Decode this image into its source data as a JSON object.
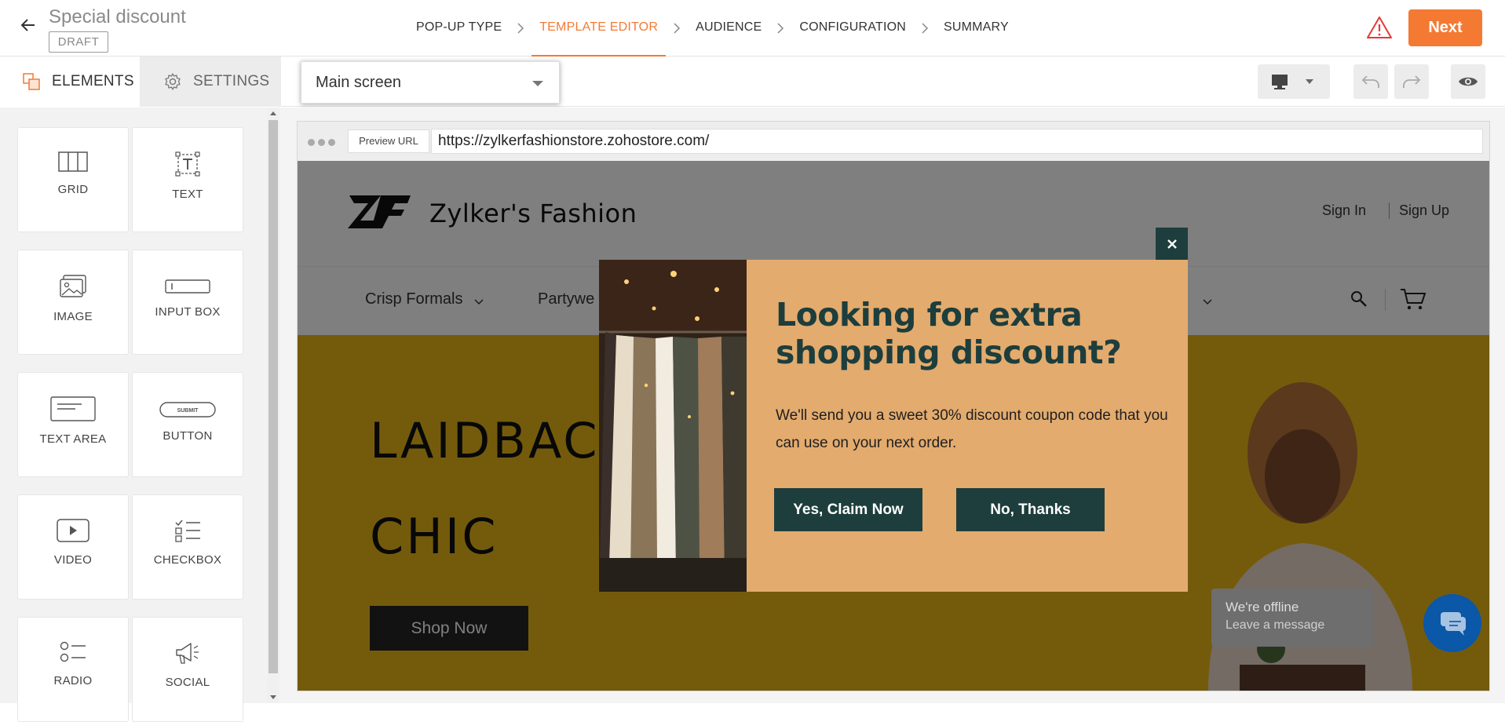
{
  "header": {
    "title": "Special discount",
    "status_badge": "DRAFT",
    "steps": [
      "POP-UP TYPE",
      "TEMPLATE EDITOR",
      "AUDIENCE",
      "CONFIGURATION",
      "SUMMARY"
    ],
    "active_step": "TEMPLATE EDITOR",
    "next_label": "Next",
    "accent_color": "#f47a34"
  },
  "toolbar": {
    "tab_elements": "ELEMENTS",
    "tab_settings": "SETTINGS",
    "screen_select_value": "Main screen",
    "device_icon": "desktop-icon"
  },
  "elements_panel": {
    "tiles": [
      {
        "label": "GRID",
        "icon": "grid-icon"
      },
      {
        "label": "TEXT",
        "icon": "text-icon"
      },
      {
        "label": "IMAGE",
        "icon": "image-icon"
      },
      {
        "label": "INPUT BOX",
        "icon": "input-box-icon"
      },
      {
        "label": "TEXT AREA",
        "icon": "text-area-icon"
      },
      {
        "label": "BUTTON",
        "icon": "button-icon"
      },
      {
        "label": "VIDEO",
        "icon": "video-icon"
      },
      {
        "label": "CHECKBOX",
        "icon": "checkbox-icon"
      },
      {
        "label": "RADIO",
        "icon": "radio-icon"
      },
      {
        "label": "SOCIAL",
        "icon": "megaphone-icon"
      }
    ],
    "button_icon_text": "SUBMIT"
  },
  "preview": {
    "url_label": "Preview URL",
    "url": "https://zylkerfashionstore.zohostore.com/",
    "site": {
      "brand": "Zylker's Fashion",
      "sign_in": "Sign In",
      "sign_up": "Sign Up",
      "nav_items": [
        "Crisp Formals",
        "Partywe"
      ],
      "hero_line_1": "LAIDBACK",
      "hero_line_2": "CHIC",
      "hero_button": "Shop Now",
      "hero_color": "#e8b718"
    },
    "chat": {
      "title": "We're offline",
      "subtitle": "Leave a message"
    }
  },
  "popup": {
    "heading_line_1": "Looking for extra",
    "heading_line_2": "shopping discount?",
    "body": "We'll send you a sweet 30% discount coupon code that you can use on your next order.",
    "primary_button": "Yes, Claim Now",
    "secondary_button": "No, Thanks",
    "background_color": "#e3ab6e",
    "text_color": "#1d3e3c"
  }
}
